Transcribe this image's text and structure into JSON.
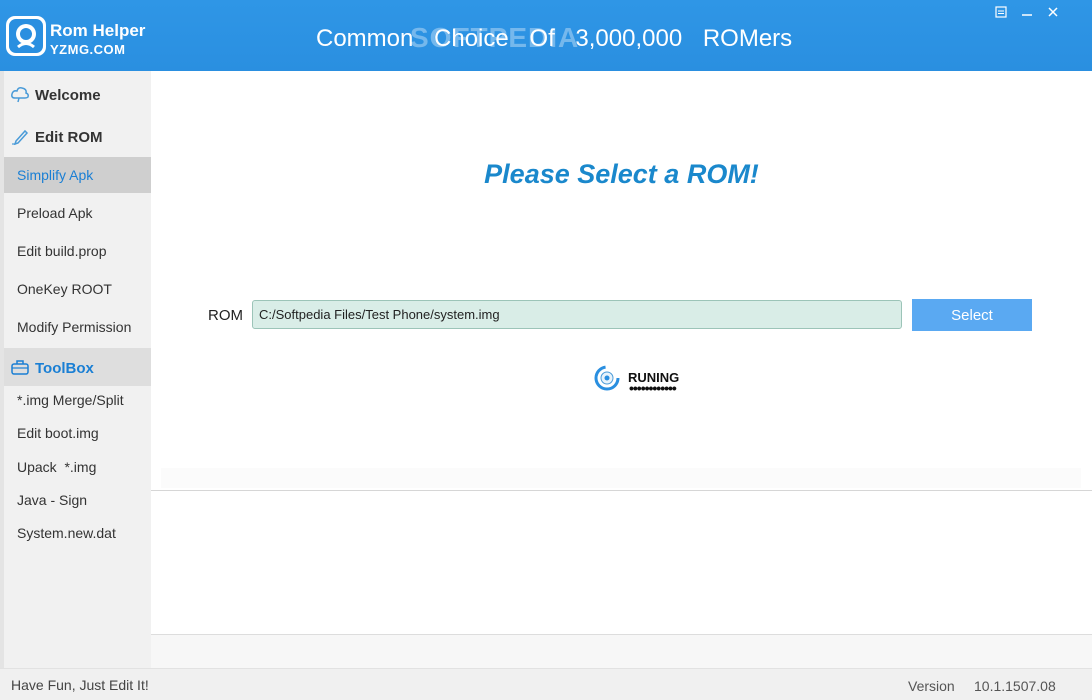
{
  "header": {
    "brand_name": "Rom Helper",
    "brand_site": "YZMG.COM",
    "slogan": "Common  Choice  Of  3,000,000  ROMers",
    "watermark": "SOFTPEDIA",
    "controls": [
      "restore-icon",
      "minimize-icon",
      "close-icon"
    ]
  },
  "sidebar": {
    "welcome": "Welcome",
    "edit_rom": "Edit ROM",
    "edit_items": [
      "Simplify Apk",
      "Preload Apk",
      "Edit build.prop",
      "OneKey ROOT",
      "Modify Permission"
    ],
    "toolbox": "ToolBox",
    "toolbox_items": [
      "*.img Merge/Split",
      "Edit boot.img",
      "Upack  *.img",
      "Java - Sign",
      "System.new.dat"
    ]
  },
  "main": {
    "title": "Please Select a ROM!",
    "rom_label": "ROM",
    "rom_path": "C:/Softpedia Files/Test Phone/system.img",
    "select_label": "Select",
    "status": "RUNING",
    "status_dots": "••••••••••••"
  },
  "footer": {
    "tagline": "Have Fun, Just Edit It!",
    "version_label": "Version",
    "version": "10.1.1507.08"
  },
  "colors": {
    "header": "#2a8fe0",
    "accent": "#1a88cc",
    "button": "#5aa9f2",
    "input_bg": "#d9ede7"
  }
}
